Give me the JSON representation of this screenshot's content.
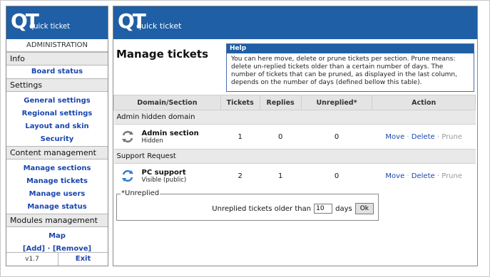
{
  "brand": {
    "logo_big": "QT",
    "logo_text": "quick ticket"
  },
  "sidebar": {
    "administration": "ADMINISTRATION",
    "sections": [
      {
        "title": "Info",
        "links": [
          "Board status"
        ]
      },
      {
        "title": "Settings",
        "links": [
          "General settings",
          "Regional settings",
          "Layout and skin",
          "Security"
        ]
      },
      {
        "title": "Content management",
        "links": [
          "Manage sections",
          "Manage tickets",
          "Manage users",
          "Manage status"
        ]
      },
      {
        "title": "Modules management",
        "links": [
          "Map",
          "[Add] · [Remove]"
        ]
      }
    ],
    "version": "v1.7",
    "exit": "Exit"
  },
  "main": {
    "title": "Manage tickets",
    "help_title": "Help",
    "help_text": "You can here move, delete or prune tickets per section. Prune means: delete un-replied tickets older than a certain number of days. The number of tickets that can be pruned, as displayed in the last column, depends on the number of days (defined bellow this table).",
    "columns": [
      "Domain/Section",
      "Tickets",
      "Replies",
      "Unreplied*",
      "Action"
    ],
    "groups": [
      {
        "domain": "Admin hidden domain",
        "section": "Admin section",
        "visibility": "Hidden",
        "tickets": "1",
        "replies": "0",
        "unreplied": "0"
      },
      {
        "domain": "Support Request",
        "section": "PC support",
        "visibility": "Visible (public)",
        "tickets": "2",
        "replies": "1",
        "unreplied": "0"
      }
    ],
    "actions": {
      "move": "Move",
      "delete": "Delete",
      "prune": "Prune",
      "sep": "·"
    },
    "unreplied_legend": "*Unreplied",
    "unreplied_label": "Unreplied tickets older than",
    "unreplied_days_value": "10",
    "unreplied_days_unit": "days",
    "ok_button": "Ok"
  }
}
